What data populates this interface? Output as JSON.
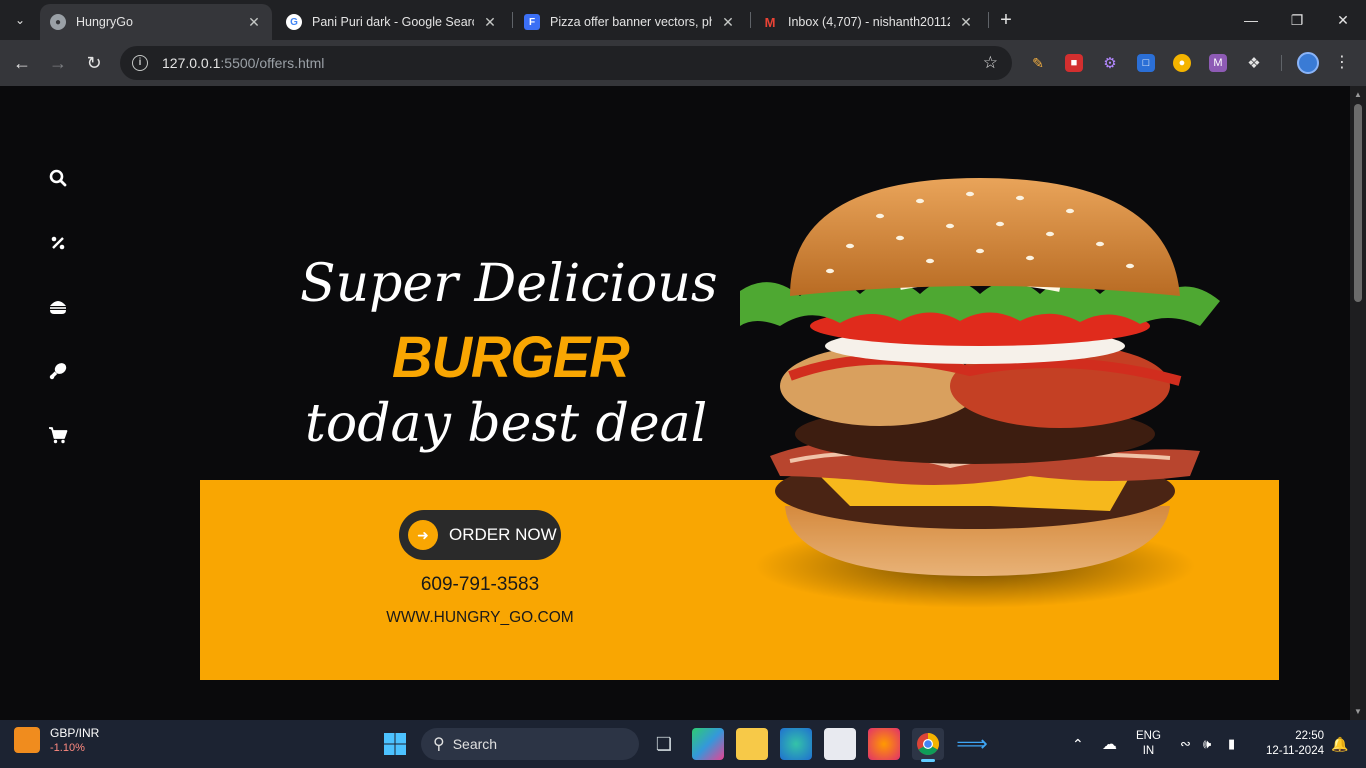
{
  "browser": {
    "tabs": [
      {
        "title": "HungryGo",
        "active": true
      },
      {
        "title": "Pani Puri dark - Google Search",
        "active": false
      },
      {
        "title": "Pizza offer banner vectors, phot",
        "active": false
      },
      {
        "title": "Inbox (4,707) - nishanth2011200",
        "active": false
      }
    ],
    "url_host": "127.0.0.1",
    "url_path": ":5500/offers.html"
  },
  "page": {
    "sidebar_icons": [
      "search-icon",
      "percent-icon",
      "burger-icon",
      "drumstick-icon",
      "cart-icon"
    ],
    "headline_1": "Super Delicious",
    "headline_2": "BURGER",
    "headline_3": "today best deal",
    "order_button": "ORDER NOW",
    "phone": "609-791-3583",
    "website": "WWW.HUNGRY_GO.COM",
    "colors": {
      "accent": "#f9a602",
      "background": "#0a0a0c",
      "button": "#2a2a2a"
    }
  },
  "taskbar": {
    "widget_title": "GBP/INR",
    "widget_value": "-1.10%",
    "search_placeholder": "Search",
    "lang_1": "ENG",
    "lang_2": "IN",
    "time": "22:50",
    "date": "12-11-2024"
  }
}
